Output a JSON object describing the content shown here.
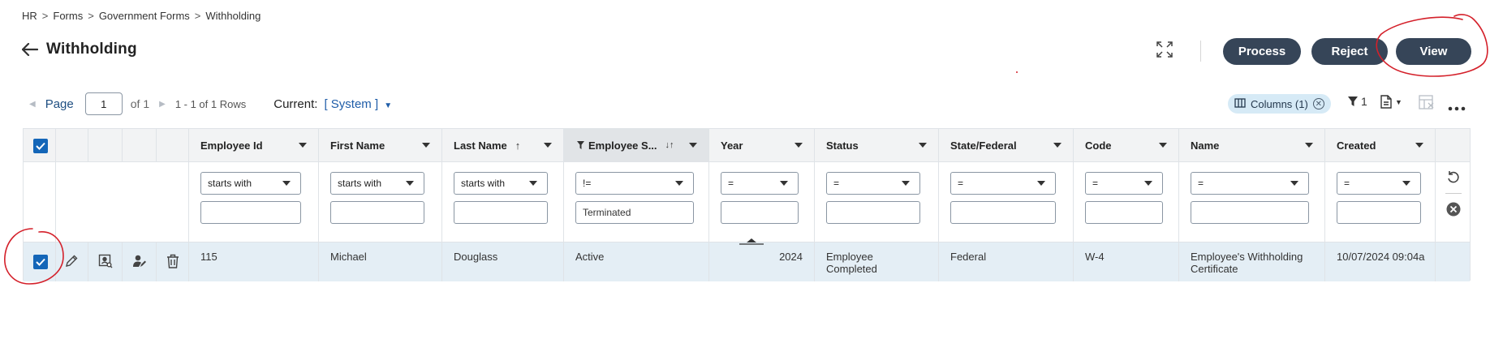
{
  "breadcrumb": [
    "HR",
    "Forms",
    "Government Forms",
    "Withholding"
  ],
  "breadcrumb_sep": ">",
  "page_title": "Withholding",
  "actions": {
    "process": "Process",
    "reject": "Reject",
    "view": "View"
  },
  "pager": {
    "page_label": "Page",
    "page_value": "1",
    "of_label": "of 1",
    "range": "1 - 1 of 1 Rows",
    "current_label": "Current:",
    "view_selector": "[ System ]"
  },
  "toolbar": {
    "columns_chip": "Columns (1)",
    "filter_count": "1"
  },
  "columns": [
    {
      "label": "Employee Id",
      "operator": "starts with",
      "filter_value": ""
    },
    {
      "label": "First Name",
      "operator": "starts with",
      "filter_value": ""
    },
    {
      "label": "Last Name",
      "operator": "starts with",
      "filter_value": "",
      "sort": "↑"
    },
    {
      "label": "Employee S...",
      "operator": "!=",
      "filter_value": "Terminated",
      "sort": "↓↑"
    },
    {
      "label": "Year",
      "operator": "=",
      "filter_value": ""
    },
    {
      "label": "Status",
      "operator": "=",
      "filter_value": ""
    },
    {
      "label": "State/Federal",
      "operator": "=",
      "filter_value": ""
    },
    {
      "label": "Code",
      "operator": "=",
      "filter_value": ""
    },
    {
      "label": "Name",
      "operator": "=",
      "filter_value": ""
    },
    {
      "label": "Created",
      "operator": "=",
      "filter_value": ""
    }
  ],
  "rows": [
    {
      "selected": true,
      "cells": [
        "115",
        "Michael",
        "Douglass",
        "Active",
        "2024",
        "Employee Completed",
        "Federal",
        "W-4",
        "Employee's Withholding Certificate",
        "10/07/2024 09:04a"
      ]
    }
  ],
  "colors": {
    "primary_button": "#364558",
    "link": "#1f4f82",
    "checkbox": "#1466b8",
    "row_selected": "#e4eef5",
    "annotation": "#d4202a"
  },
  "icons": [
    "back-arrow-icon",
    "expand-icon",
    "filter-icon",
    "export-icon",
    "column-layout-icon",
    "more-icon",
    "edit-icon",
    "view-details-icon",
    "assign-user-icon",
    "delete-icon",
    "reset-icon",
    "clear-filter-icon"
  ]
}
